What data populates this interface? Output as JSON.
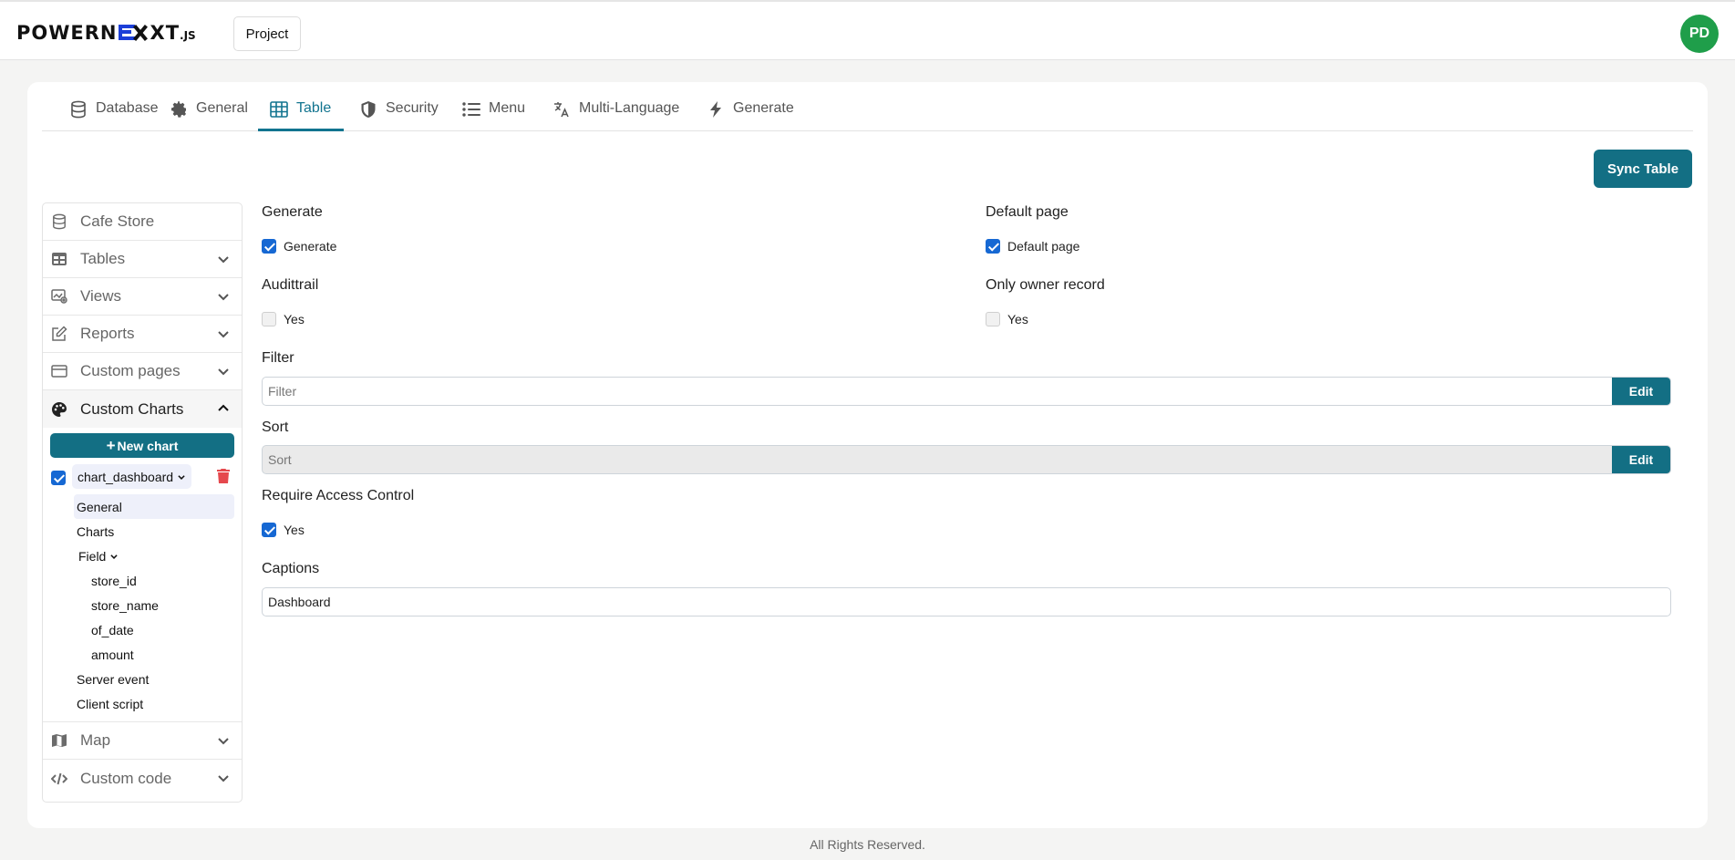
{
  "header": {
    "logo_left": "POWERN",
    "logo_right": "XT",
    "logo_suffix": ".JS",
    "project_label": "Project",
    "avatar_initials": "PD",
    "avatar_color": "#1f9e4a"
  },
  "tabs": [
    {
      "label": "Database",
      "icon": "database-icon"
    },
    {
      "label": "General",
      "icon": "gear-icon"
    },
    {
      "label": "Table",
      "icon": "table-icon",
      "active": true
    },
    {
      "label": "Security",
      "icon": "shield-icon"
    },
    {
      "label": "Menu",
      "icon": "list-icon"
    },
    {
      "label": "Multi-Language",
      "icon": "translate-icon"
    },
    {
      "label": "Generate",
      "icon": "bolt-icon"
    }
  ],
  "sync_button": "Sync Table",
  "accent_color": "#136f84",
  "sidebar": {
    "project_name": "Cafe Store",
    "items": [
      "Tables",
      "Views",
      "Reports",
      "Custom pages",
      "Custom Charts",
      "Map",
      "Custom code"
    ],
    "new_chart": "New chart",
    "chart_name": "chart_dashboard",
    "tree": {
      "general": "General",
      "charts": "Charts",
      "field": "Field",
      "fields": [
        "store_id",
        "store_name",
        "of_date",
        "amount"
      ],
      "server_event": "Server event",
      "client_script": "Client script"
    }
  },
  "form": {
    "generate_label": "Generate",
    "generate_check": "Generate",
    "default_page_label": "Default page",
    "default_page_check": "Default page",
    "audittrail_label": "Audittrail",
    "audittrail_check": "Yes",
    "only_owner_label": "Only owner record",
    "only_owner_check": "Yes",
    "filter_label": "Filter",
    "filter_placeholder": "Filter",
    "filter_edit": "Edit",
    "sort_label": "Sort",
    "sort_placeholder": "Sort",
    "sort_edit": "Edit",
    "require_ac_label": "Require Access Control",
    "require_ac_check": "Yes",
    "captions_label": "Captions",
    "captions_value": "Dashboard"
  },
  "footer": "All Rights Reserved."
}
